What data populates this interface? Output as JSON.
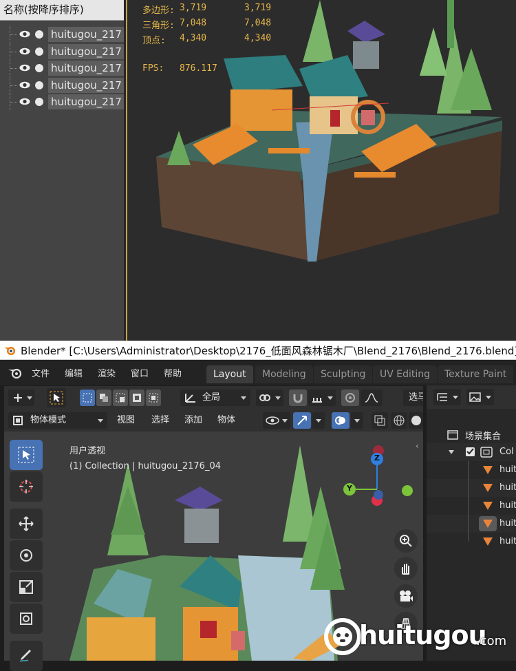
{
  "outliner": {
    "header": "名称(按降序排序)",
    "items": [
      "huitugou_217",
      "huitugou_217",
      "huitugou_217",
      "huitugou_217",
      "huitugou_217"
    ]
  },
  "stats": {
    "polys_label": "多边形:",
    "polys_value": "3,719",
    "polys_total": "3,719",
    "tris_label": "三角形:",
    "tris_value": "7,048",
    "tris_total": "7,048",
    "verts_label": "顶点:",
    "verts_value": "4,340",
    "verts_total": "4,340",
    "fps_label": "FPS:",
    "fps_value": "876.117"
  },
  "window": {
    "title": "Blender* [C:\\Users\\Administrator\\Desktop\\2176_低面风森林锯木厂\\Blend_2176\\Blend_2176.blend]"
  },
  "menubar": {
    "items": [
      "文件",
      "编辑",
      "渲染",
      "窗口",
      "帮助"
    ],
    "workspaces": [
      "Layout",
      "Modeling",
      "Sculpting",
      "UV Editing",
      "Texture Paint"
    ],
    "active_workspace": "Layout"
  },
  "header1": {
    "transform_orientation": "全局",
    "select_label": "选马"
  },
  "header2": {
    "mode": "物体模式",
    "view": "视图",
    "select": "选择",
    "add": "添加",
    "object": "物体"
  },
  "viewport": {
    "perspective": "用户透视",
    "collection_info": "(1) Collection | huitugou_2176_04"
  },
  "gizmo": {
    "z": "Z",
    "y": "Y"
  },
  "right_panel": {
    "scene_collection": "场景集合",
    "collection": "Col",
    "items": [
      "huit",
      "huit",
      "huit",
      "huit",
      "huit"
    ]
  },
  "watermark": {
    "brand": "huitugou",
    "suffix": ".com"
  },
  "colors": {
    "accent_blue": "#4772b3",
    "stat_yellow": "#e7b84b",
    "object_orange": "#e8853a"
  }
}
